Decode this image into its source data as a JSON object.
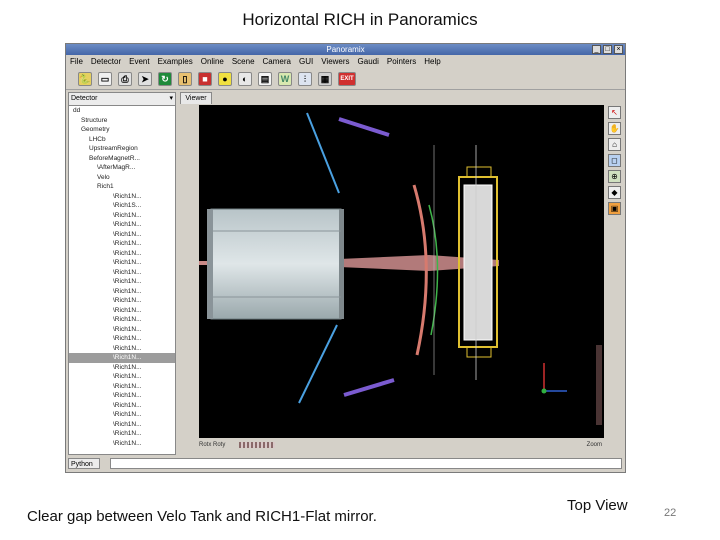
{
  "slide": {
    "title": "Horizontal RICH in  Panoramics",
    "caption": "Clear gap between  Velo Tank and  RICH1-Flat mirror.",
    "view_label": "Top View",
    "page_number": "22"
  },
  "window": {
    "title": "Panoramix",
    "menu": [
      "File",
      "Detector",
      "Event",
      "Examples",
      "Online",
      "Scene",
      "Camera",
      "GUI",
      "Viewers",
      "Gaudi",
      "Pointers",
      "Help"
    ],
    "toolbar_icons": [
      "python-icon",
      "folder-icon",
      "print-icon",
      "export-icon",
      "refresh-icon",
      "next-event-icon",
      "stop-icon",
      "camera-icon",
      "color-icon",
      "dialog-icon",
      "w-icon",
      "filter-icon",
      "grid-icon",
      "exit-icon"
    ]
  },
  "left_panel": {
    "combo": "Detector",
    "tree": [
      "dd",
      "Structure",
      "Geometry",
      "LHCb",
      "UpstreamRegion",
      "BeforeMagnetR...",
      "\\AfterMagR...",
      "Velo",
      "Rich1",
      "\\Rich1N...",
      "\\Rich1S...",
      "\\Rich1N...",
      "\\Rich1N...",
      "\\Rich1N...",
      "\\Rich1N...",
      "\\Rich1N...",
      "\\Rich1N...",
      "\\Rich1N...",
      "\\Rich1N...",
      "\\Rich1N...",
      "\\Rich1N...",
      "\\Rich1N...",
      "\\Rich1N...",
      "\\Rich1N...",
      "\\Rich1N...",
      "\\Rich1N...",
      "\\Rich1N...",
      "\\Rich1N...",
      "\\Rich1N...",
      "\\Rich1N...",
      "\\Rich1N...",
      "\\Rich1N...",
      "\\Rich1N...",
      "\\Rich1N...",
      "\\Rich1N...",
      "\\Rich1N..."
    ],
    "selected_index": 26
  },
  "right_panel": {
    "tab": "Viewer",
    "rotation_label": "Rotx  Roty",
    "zoom_label": "Zoom"
  },
  "python": {
    "label": "Python"
  },
  "colors": {
    "viewer_bg": "#000000",
    "slide_bg": "#ffffff"
  }
}
